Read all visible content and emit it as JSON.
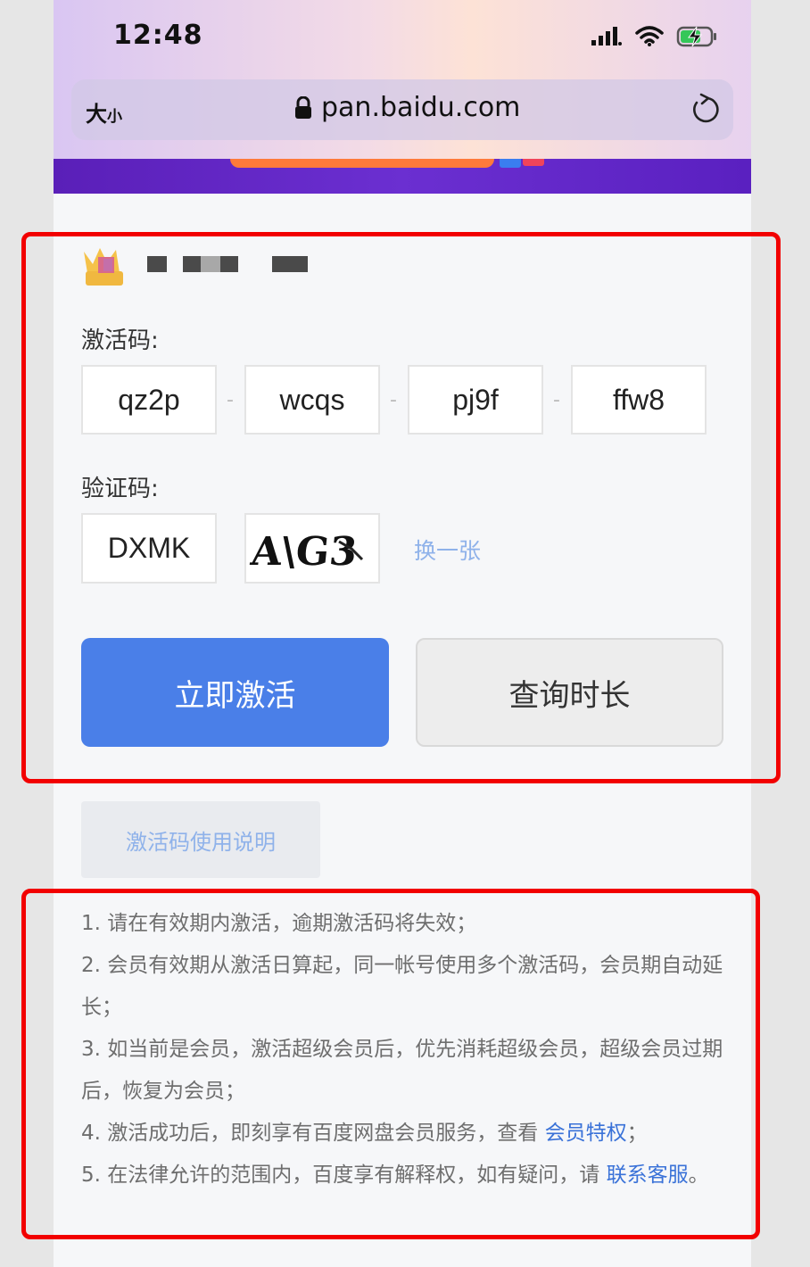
{
  "status_bar": {
    "time": "12:48"
  },
  "browser": {
    "text_size_big": "大",
    "text_size_small": "小",
    "url": "pan.baidu.com"
  },
  "card": {
    "activation_label": "激活码:",
    "activation_codes": [
      "qz2p",
      "wcqs",
      "pj9f",
      "ffw8"
    ],
    "separator": "-",
    "captcha_label": "验证码:",
    "captcha_value": "DXMK",
    "captcha_image_text": "A\\G3",
    "refresh_label": "换一张",
    "activate_button": "立即激活",
    "query_button": "查询时长",
    "instructions_button": "激活码使用说明"
  },
  "notes": {
    "n1": "1. 请在有效期内激活，逾期激活码将失效；",
    "n2": "2. 会员有效期从激活日算起，同一帐号使用多个激活码，会员期自动延长；",
    "n3": "3. 如当前是会员，激活超级会员后，优先消耗超级会员，超级会员过期后，恢复为会员；",
    "n4_text": "4. 激活成功后，即刻享有百度网盘会员服务，查看 ",
    "n4_link": "会员特权",
    "n4_end": "；",
    "n5_text": "5. 在法律允许的范围内，百度享有解释权，如有疑问，请 ",
    "n5_link": "联系客服",
    "n5_end": "。"
  },
  "colors": {
    "accent": "#4a7fe8",
    "link": "#3a72d8",
    "highlight_frame": "#f20000"
  }
}
